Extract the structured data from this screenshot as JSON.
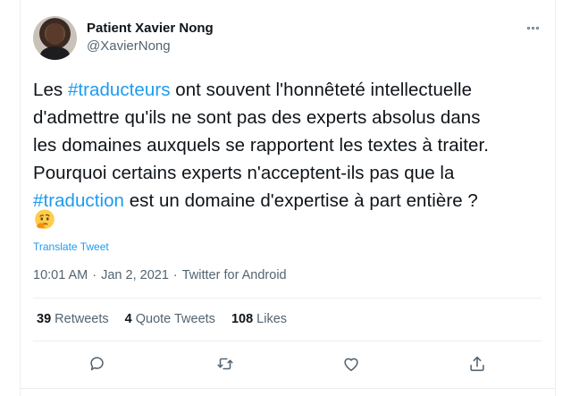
{
  "author": {
    "display_name": "Patient Xavier Nong",
    "handle": "@XavierNong"
  },
  "tweet": {
    "lines": [
      [
        {
          "t": "Les ",
          "tag": false
        },
        {
          "t": "#traducteurs",
          "tag": true
        },
        {
          "t": " ont souvent l'honnêteté intellectuelle",
          "tag": false
        }
      ],
      [
        {
          "t": "d'admettre qu'ils ne sont pas des experts absolus dans",
          "tag": false
        }
      ],
      [
        {
          "t": "les domaines auxquels se rapportent les textes à traiter.",
          "tag": false
        }
      ],
      [
        {
          "t": "Pourquoi certains experts n'acceptent-ils pas que la",
          "tag": false
        }
      ],
      [
        {
          "t": "#traduction",
          "tag": true
        },
        {
          "t": " est un domaine d'expertise à part entière ?",
          "tag": false
        }
      ]
    ],
    "emoji": "thinking-face",
    "translate_label": "Translate Tweet"
  },
  "meta": {
    "time": "10:01 AM",
    "separator": "·",
    "date": "Jan 2, 2021",
    "source": "Twitter for Android"
  },
  "stats": {
    "retweets_count": "39",
    "retweets_label": "Retweets",
    "quotes_count": "4",
    "quotes_label": "Quote Tweets",
    "likes_count": "108",
    "likes_label": "Likes"
  },
  "colors": {
    "accent": "#1d9bf0",
    "muted": "#536471",
    "text": "#0f1419",
    "border": "#ebeef0"
  },
  "icons": {
    "reply": "speech-bubble-icon",
    "retweet": "retweet-arrows-icon",
    "like": "heart-icon",
    "share": "share-upload-icon",
    "more": "more-options-icon"
  }
}
